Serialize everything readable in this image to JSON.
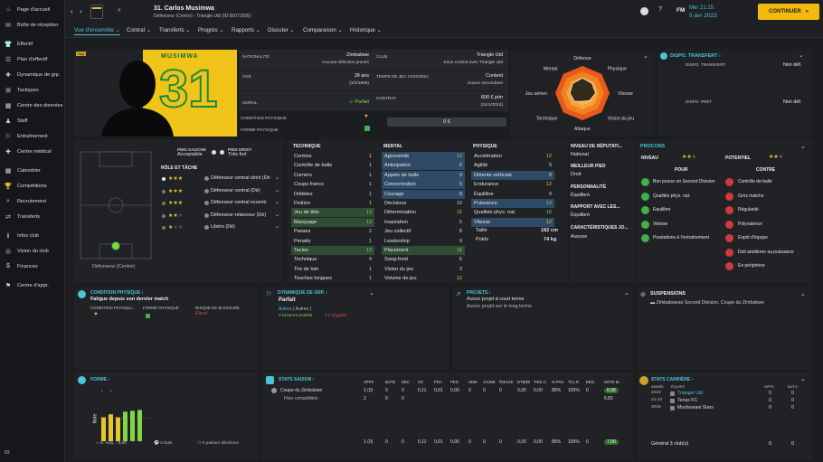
{
  "sidebar": {
    "items": [
      "Page d'accueil",
      "Boîte de réception",
      "Effectif",
      "Plan d'effectif",
      "Dynamique de grp.",
      "Tactiques",
      "Centre des données",
      "Staff",
      "Entraînement",
      "Centre médical",
      "Calendrier",
      "Compétitions",
      "Recrutement",
      "Transferts",
      "Infos club",
      "Vision du club",
      "Finances",
      "Centre d'appr."
    ],
    "footer": "83"
  },
  "header": {
    "player_title": "31. Carlos Musimwa",
    "player_sub": "Défenseur (Centre) - Triangle Utd (ID:95071895)",
    "time": "Mer 21:15",
    "date": "5 avr 2023",
    "continue": "CONTINUER",
    "news_title": "NOUVEAUX CONSEILS DISPONIBLES",
    "news_text": "Entraînement individuel à saisie, Changements à l'entraînement",
    "fm": "FM"
  },
  "tabs": [
    "Vue d'ensemble",
    "Contrat",
    "Transferts",
    "Progrès",
    "Rapports",
    "Discuter",
    "Comparaison",
    "Historique"
  ],
  "profile": {
    "shirt_name": "MUSIMWA",
    "shirt_number": "31",
    "rep_badge": "Rep",
    "nationality_label": "NATIONALITÉ",
    "nationality": "Zimbabwe",
    "nationality_sub": "Aucune sélection jeunes",
    "club_label": "CLUB",
    "club": "Triangle Utd",
    "club_sub": "Sous contrat avec Triangle Utd",
    "age_label": "ÂGE",
    "age": "28 ans",
    "dob": "(3/2/1995)",
    "playing_time_label": "TEMPS DE JEU CONVENU",
    "playing_time": "Content",
    "playing_time_sub": "Joueur secondaire",
    "morale_label": "MORAL",
    "morale": "Parfait",
    "contract_label": "CONTRAT",
    "contract_wage": "600 € p/m",
    "contract_end": "(31/1/2024)",
    "condition_label": "CONDITION PHYSIQUE",
    "form_label": "FORME PHYSIQUE",
    "value": "0 €"
  },
  "radar": {
    "labels": [
      "Défense",
      "Physique",
      "Vitesse",
      "Vision du jeu",
      "Attaque",
      "Technique",
      "Jeu aérien",
      "Mental"
    ],
    "values": [
      0.55,
      0.5,
      0.48,
      0.38,
      0.3,
      0.42,
      0.46,
      0.5
    ]
  },
  "scouting": {
    "title": "DISPO. TRANSFERT",
    "transfer_label": "DISPO. TRANSFERT",
    "transfer_val": "Non déf.",
    "loan_label": "DISPO. PRÊT",
    "loan_val": "Non déf."
  },
  "roles": {
    "left_foot_label": "PIED GAUCHE",
    "left_foot": "Acceptable",
    "right_foot_label": "PIED DROIT",
    "right_foot": "Très fort",
    "title": "RÔLE ET TÂCHE",
    "items": [
      "Défenseur central strict (Dé",
      "Défenseur central (Dé)",
      "Défenseur central excentr",
      "Défenseur-relanceur (Dé)",
      "Libéro (Dé)"
    ],
    "stars": [
      2.5,
      2.5,
      2.5,
      2,
      1
    ],
    "position": "Défenseur (Centre)"
  },
  "attributes": {
    "technique": {
      "title": "TECHNIQUE",
      "items": [
        [
          "Centres",
          "1"
        ],
        [
          "Contrôle de balle",
          "1"
        ],
        [
          "Corners",
          "1"
        ],
        [
          "Coups francs",
          "1"
        ],
        [
          "Dribbles",
          "1"
        ],
        [
          "Finition",
          "1"
        ],
        [
          "Jeu de tête",
          "13"
        ],
        [
          "Marquage",
          "13"
        ],
        [
          "Passes",
          "2"
        ],
        [
          "Penalty",
          "1"
        ],
        [
          "Tacles",
          "13"
        ],
        [
          "Technique",
          "4"
        ],
        [
          "Tirs de loin",
          "1"
        ],
        [
          "Touches longues",
          "1"
        ]
      ]
    },
    "mental": {
      "title": "MENTAL",
      "items": [
        [
          "Agressivité",
          "13"
        ],
        [
          "Anticipation",
          "6"
        ],
        [
          "Appels de balle",
          "9"
        ],
        [
          "Concentration",
          "6"
        ],
        [
          "Courage",
          "8"
        ],
        [
          "Décisions",
          "10"
        ],
        [
          "Détermination",
          "11"
        ],
        [
          "Inspiration",
          "5"
        ],
        [
          "Jeu collectif",
          "8"
        ],
        [
          "Leadership",
          "9"
        ],
        [
          "Placement",
          "11"
        ],
        [
          "Sang-froid",
          "6"
        ],
        [
          "Vision du jeu",
          "3"
        ],
        [
          "Volume de jeu",
          "12"
        ]
      ]
    },
    "physique": {
      "title": "PHYSIQUE",
      "items": [
        [
          "Accélération",
          "12"
        ],
        [
          "Agilité",
          "9"
        ],
        [
          "Détente verticale",
          "8"
        ],
        [
          "Endurance",
          "12"
        ],
        [
          "Équilibre",
          "9"
        ],
        [
          "Puissance",
          "14"
        ],
        [
          "Qualités phys. nat.",
          "16"
        ],
        [
          "Vitesse",
          "12"
        ]
      ]
    },
    "height_label": "Taille",
    "height": "182 cm",
    "weight_label": "Poids",
    "weight": "74 kg"
  },
  "info": {
    "rep_label": "NIVEAU DE RÉPUTATI...",
    "rep": "National",
    "foot_label": "MEILLEUR PIED",
    "foot": "Droit",
    "pers_label": "PERSONNALITÉ",
    "pers": "Équilibré",
    "media_label": "RAPPORT AVEC LES...",
    "media": "Équilibré",
    "traits_label": "CARACTÉRISTIQUES JO...",
    "traits": "Aucune"
  },
  "procons": {
    "title": "PROCONS",
    "level_label": "NIVEAU",
    "potential_label": "POTENTIEL",
    "pour_label": "POUR",
    "contre_label": "CONTRE",
    "pour": [
      "Bon joueur en Second Division",
      "Qualités phys. nat.",
      "Équilibre",
      "Vitesse",
      "Prestations à l'entraînement"
    ],
    "contre": [
      "Contrôle de balle",
      "Gros matchs",
      "Régularité",
      "Polyvalence",
      "Esprit d'équipe",
      "Doit améliorer sa puissance",
      "En périphérie"
    ]
  },
  "condition": {
    "title": "CONDITION PHYSIQUE",
    "subtitle": "Fatigue depuis son dernier match",
    "c1": "CONDITION PHYSIQU...",
    "c2": "FORME PHYSIQUE",
    "c3": "RISQUE DE BLESSURE",
    "risk": "Élevé"
  },
  "dynamics": {
    "title": "DYNAMIQUE DE GRP.",
    "value": "Parfait",
    "group": "Autres",
    "group2": "( Autres )",
    "pos": "2 facteurs positifs",
    "neg": "2 négatifs"
  },
  "projects": {
    "title": "PROJETS",
    "p1": "Aucun projet à court terme",
    "p2": "Aucun projet sur le long terme"
  },
  "suspensions": {
    "title": "SUSPENSIONS",
    "text": "Zimbabwean Second Division, Coupe du Zimbabwe"
  },
  "form": {
    "title": "FORME",
    "ylabel": "Note",
    "avg": "N. moy. : 6,98",
    "goals": "0 buts",
    "assists": "0 passes décisives",
    "bars": [
      0.55,
      0.62,
      0.55,
      0.68,
      0.7,
      0.72
    ]
  },
  "season": {
    "title": "STATS SAISON",
    "headers": [
      "APPS",
      "BUTS",
      "DÉC",
      "XG",
      "POA",
      "PEN",
      "HDM",
      "JAUNE",
      "ROUGE",
      "DTB/90",
      "TIRS C.",
      "% PAS.",
      "TCL R",
      "DÉG.",
      "NOTE M..."
    ],
    "rows": [
      {
        "name": "Coupe du Zimbabwe",
        "vals": [
          "1 (0)",
          "0",
          "0",
          "0,11",
          "0,01",
          "0,00",
          "0",
          "0",
          "0",
          "0,00",
          "0,00",
          "85%",
          "100%",
          "0",
          "6,98"
        ]
      },
      {
        "name": "Hors compétition",
        "vals": [
          "2",
          "0",
          "0",
          "",
          "",
          "",
          "",
          "",
          "",
          "",
          "",
          "",
          "",
          "",
          "6,82"
        ]
      }
    ],
    "total": [
      "1 (0)",
      "0",
      "0",
      "0,11",
      "0,01",
      "0,00",
      "0",
      "0",
      "0",
      "0,00",
      "0,00",
      "85%",
      "100%",
      "0",
      "7,00"
    ]
  },
  "career": {
    "title": "STATS CARRIÈRE",
    "col_year": "ANNÉE",
    "col_team": "ÉQUIPE",
    "col_apps": "APPS",
    "col_goals": "BUTS",
    "rows": [
      [
        "2023",
        "Triangle Utd",
        "0",
        "0"
      ],
      [
        "21-22",
        "Tenax FC",
        "0",
        "0"
      ],
      [
        "2019",
        "Mushowani Stars",
        "0",
        "0"
      ]
    ],
    "total_label": "Général 3 club(s)",
    "total_apps": "0",
    "total_goals": "0"
  },
  "colors": {
    "accent": "#4cc3d8",
    "continue": "#f2b90f",
    "star": "#e7c62d",
    "good": "#7fd64a",
    "bad": "#e04848"
  }
}
